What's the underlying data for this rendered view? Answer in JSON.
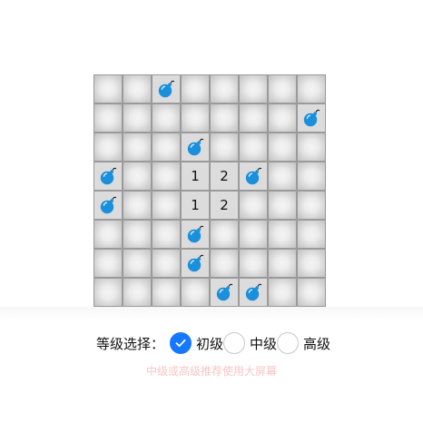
{
  "game": {
    "rows": 8,
    "cols": 8,
    "grid": [
      [
        "covered",
        "covered",
        "bomb",
        "covered",
        "covered",
        "covered",
        "covered",
        "covered"
      ],
      [
        "covered",
        "covered",
        "covered",
        "covered",
        "covered",
        "covered",
        "covered",
        "bomb"
      ],
      [
        "covered",
        "covered",
        "covered",
        "bomb",
        "covered",
        "covered",
        "covered",
        "covered"
      ],
      [
        "bomb",
        "covered",
        "covered",
        "1",
        "2",
        "bomb",
        "covered",
        "covered"
      ],
      [
        "bomb",
        "covered",
        "covered",
        "1",
        "2",
        "covered",
        "covered",
        "covered"
      ],
      [
        "covered",
        "covered",
        "covered",
        "bomb",
        "covered",
        "covered",
        "covered",
        "covered"
      ],
      [
        "covered",
        "covered",
        "covered",
        "bomb",
        "covered",
        "covered",
        "covered",
        "covered"
      ],
      [
        "covered",
        "covered",
        "covered",
        "covered",
        "bomb",
        "bomb",
        "covered",
        "covered"
      ]
    ]
  },
  "level_select": {
    "label": "等级选择：",
    "options": [
      {
        "label": "初级",
        "checked": true
      },
      {
        "label": "中级",
        "checked": false
      },
      {
        "label": "高级",
        "checked": false
      }
    ]
  },
  "hint": "中级或高级推荐使用大屏幕",
  "colors": {
    "bomb": "#1a8fdc",
    "radio_checked": "#1677ff"
  },
  "icons": {
    "bomb": "bomb-icon",
    "check": "check-icon"
  }
}
